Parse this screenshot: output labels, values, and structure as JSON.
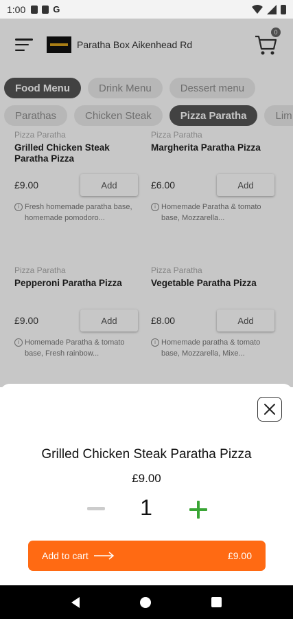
{
  "status_bar": {
    "time": "1:00",
    "g_label": "G"
  },
  "header": {
    "shop_name": "Paratha Box Aikenhead Rd",
    "cart_count": "0"
  },
  "menu_tabs": [
    {
      "label": "Food Menu",
      "active": true
    },
    {
      "label": "Drink Menu",
      "active": false
    },
    {
      "label": "Dessert menu",
      "active": false
    }
  ],
  "category_tabs": [
    {
      "label": "Parathas",
      "active": false
    },
    {
      "label": "Chicken Steak",
      "active": false
    },
    {
      "label": "Pizza Paratha",
      "active": true
    },
    {
      "label": "Lim",
      "active": false
    }
  ],
  "products": [
    {
      "category": "Pizza Paratha",
      "name": "Grilled Chicken Steak Paratha Pizza",
      "price": "£9.00",
      "add_label": "Add",
      "description": "Fresh homemade paratha base, homemade pomodoro..."
    },
    {
      "category": "Pizza Paratha",
      "name": "Margherita Paratha Pizza",
      "price": "£6.00",
      "add_label": "Add",
      "description": "Homemade Paratha & tomato base, Mozzarella..."
    },
    {
      "category": "Pizza Paratha",
      "name": "Pepperoni Paratha Pizza",
      "price": "£9.00",
      "add_label": "Add",
      "description": "Homemade Paratha & tomato base, Fresh rainbow..."
    },
    {
      "category": "Pizza Paratha",
      "name": "Vegetable Paratha Pizza",
      "price": "£8.00",
      "add_label": "Add",
      "description": "Homemade paratha & tomato base, Mozzarella, Mixe..."
    }
  ],
  "sheet": {
    "title": "Grilled Chicken Steak Paratha Pizza",
    "price": "£9.00",
    "quantity": "1",
    "add_to_cart_label": "Add to cart",
    "add_to_cart_total": "£9.00"
  },
  "colors": {
    "accent": "#ff6a13",
    "plus": "#3aa535",
    "chip_active": "#555555"
  },
  "icons": [
    "menu-icon",
    "cart-icon",
    "info-icon",
    "close-icon",
    "minus-icon",
    "plus-icon",
    "arrow-right-icon",
    "back-icon",
    "home-icon",
    "recents-icon"
  ]
}
